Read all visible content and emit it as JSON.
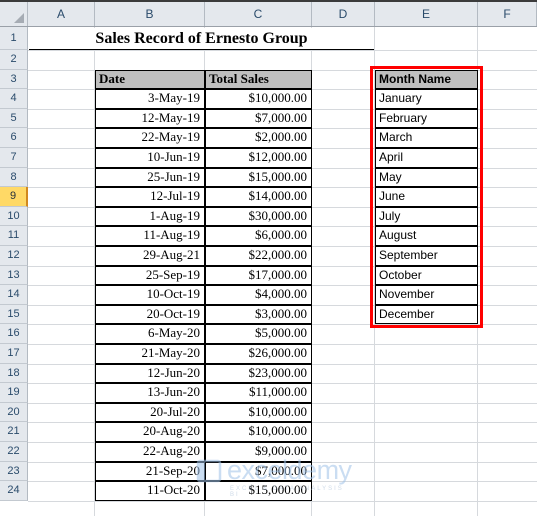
{
  "spreadsheet": {
    "column_headers": [
      "A",
      "B",
      "C",
      "D",
      "E",
      "F"
    ],
    "row_headers": [
      "1",
      "2",
      "3",
      "4",
      "5",
      "6",
      "7",
      "8",
      "9",
      "10",
      "11",
      "12",
      "13",
      "14",
      "15",
      "16",
      "17",
      "18",
      "19",
      "20",
      "21",
      "22",
      "23",
      "24"
    ],
    "selected_row": "9",
    "select_all_icon": "select-all-triangle"
  },
  "title": {
    "text": "Sales Record of Ernesto Group"
  },
  "sales_table": {
    "headers": [
      "Date",
      "Total Sales"
    ],
    "rows": [
      {
        "date": "3-May-19",
        "sales": "$10,000.00"
      },
      {
        "date": "12-May-19",
        "sales": "$7,000.00"
      },
      {
        "date": "22-May-19",
        "sales": "$2,000.00"
      },
      {
        "date": "10-Jun-19",
        "sales": "$12,000.00"
      },
      {
        "date": "25-Jun-19",
        "sales": "$15,000.00"
      },
      {
        "date": "12-Jul-19",
        "sales": "$14,000.00"
      },
      {
        "date": "1-Aug-19",
        "sales": "$30,000.00"
      },
      {
        "date": "11-Aug-19",
        "sales": "$6,000.00"
      },
      {
        "date": "29-Aug-21",
        "sales": "$22,000.00"
      },
      {
        "date": "25-Sep-19",
        "sales": "$17,000.00"
      },
      {
        "date": "10-Oct-19",
        "sales": "$4,000.00"
      },
      {
        "date": "20-Oct-19",
        "sales": "$3,000.00"
      },
      {
        "date": "6-May-20",
        "sales": "$5,000.00"
      },
      {
        "date": "21-May-20",
        "sales": "$26,000.00"
      },
      {
        "date": "12-Jun-20",
        "sales": "$23,000.00"
      },
      {
        "date": "13-Jun-20",
        "sales": "$11,000.00"
      },
      {
        "date": "20-Jul-20",
        "sales": "$10,000.00"
      },
      {
        "date": "20-Aug-20",
        "sales": "$10,000.00"
      },
      {
        "date": "22-Aug-20",
        "sales": "$9,000.00"
      },
      {
        "date": "21-Sep-20",
        "sales": "$7,000.00"
      },
      {
        "date": "11-Oct-20",
        "sales": "$15,000.00"
      }
    ]
  },
  "month_table": {
    "header": "Month Name",
    "months": [
      "January",
      "February",
      "March",
      "April",
      "May",
      "June",
      "July",
      "August",
      "September",
      "October",
      "November",
      "December"
    ],
    "highlight_color": "#ff0000"
  },
  "watermark": {
    "text": "exceldemy",
    "tagline": "EXCEL & DATA ANALYSIS BI"
  }
}
